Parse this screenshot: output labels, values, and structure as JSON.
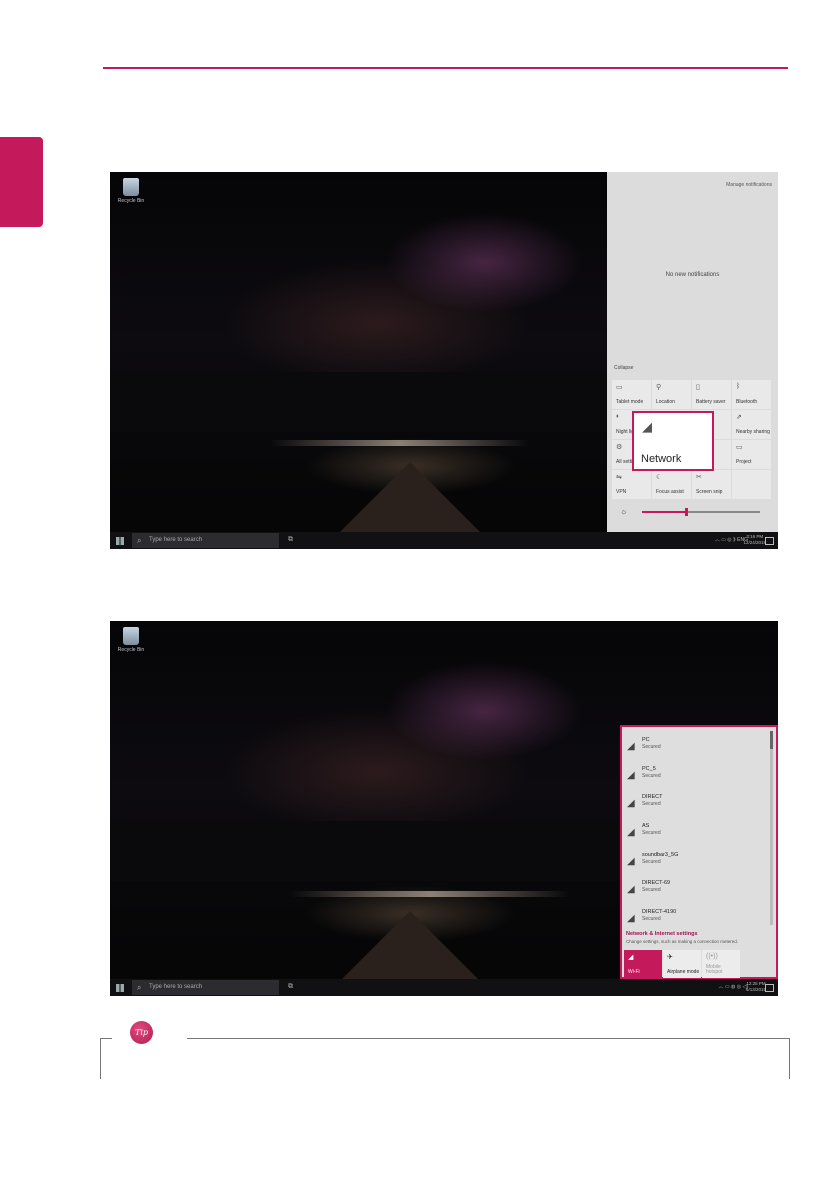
{
  "colors": {
    "accent": "#c4195b"
  },
  "desktop": {
    "recycle_bin_label": "Recycle Bin"
  },
  "taskbar": {
    "search_placeholder": "Type here to search",
    "screen1_time": "3:16 PM",
    "screen1_date": "12/24/2019",
    "screen1_lang": "ENG",
    "screen2_time": "12:25 PM",
    "screen2_date": "6/13/2019"
  },
  "action_center": {
    "manage_notifications": "Manage notifications",
    "no_new_notifications": "No new notifications",
    "collapse": "Collapse",
    "tiles": [
      {
        "label": "Tablet mode",
        "icon": "tablet-icon"
      },
      {
        "label": "Location",
        "icon": "location-icon"
      },
      {
        "label": "Battery saver",
        "icon": "battery-icon"
      },
      {
        "label": "Bluetooth",
        "icon": "bluetooth-icon"
      },
      {
        "label": "Night light",
        "icon": "night-light-icon"
      },
      {
        "label": "",
        "icon": ""
      },
      {
        "label": "mode",
        "icon": ""
      },
      {
        "label": "Nearby sharing",
        "icon": "share-icon"
      },
      {
        "label": "All settings",
        "icon": "gear-icon"
      },
      {
        "label": "",
        "icon": ""
      },
      {
        "label": "",
        "icon": ""
      },
      {
        "label": "Project",
        "icon": "project-icon"
      },
      {
        "label": "VPN",
        "icon": "vpn-icon"
      },
      {
        "label": "Focus assist",
        "icon": "moon-icon"
      },
      {
        "label": "Screen snip",
        "icon": "scissors-icon"
      },
      {
        "label": "",
        "icon": ""
      }
    ],
    "network_tile_label": "Network",
    "brightness_level": 0.37
  },
  "wifi_flyout": {
    "networks": [
      {
        "name": "PC",
        "status": "Secured"
      },
      {
        "name": "PC_5",
        "status": "Secured"
      },
      {
        "name": "DIRECT",
        "status": "Secured"
      },
      {
        "name": "AS",
        "status": "Secured"
      },
      {
        "name": "soundbar3_5G",
        "status": "Secured"
      },
      {
        "name": "DIRECT-69",
        "status": "Secured"
      },
      {
        "name": "DIRECT-4190",
        "status": "Secured"
      }
    ],
    "settings_link": "Network & Internet settings",
    "settings_desc": "Change settings, such as making a connection metered.",
    "quick": {
      "wifi": "Wi-Fi",
      "airplane": "Airplane mode",
      "hotspot_line1": "Mobile",
      "hotspot_line2": "hotspot"
    }
  },
  "tip": {
    "label": "Tip"
  }
}
